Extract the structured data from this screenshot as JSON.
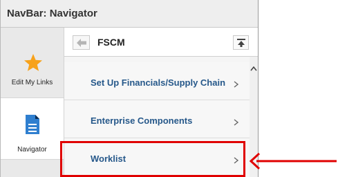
{
  "window": {
    "title": "NavBar: Navigator"
  },
  "sidebar": {
    "items": [
      {
        "label": "Edit My Links",
        "icon": "star-icon"
      },
      {
        "label": "Navigator",
        "icon": "document-icon"
      }
    ]
  },
  "navigator": {
    "title": "FSCM",
    "back_icon": "back-arrow-icon",
    "top_icon": "scroll-to-top-icon",
    "items": [
      {
        "label": "Set Up Financials/Supply Chain"
      },
      {
        "label": "Enterprise Components"
      },
      {
        "label": "Worklist"
      }
    ]
  },
  "colors": {
    "link": "#26588a",
    "star": "#f7a21b",
    "doc": "#2f7fcf",
    "highlight": "#e00000"
  }
}
